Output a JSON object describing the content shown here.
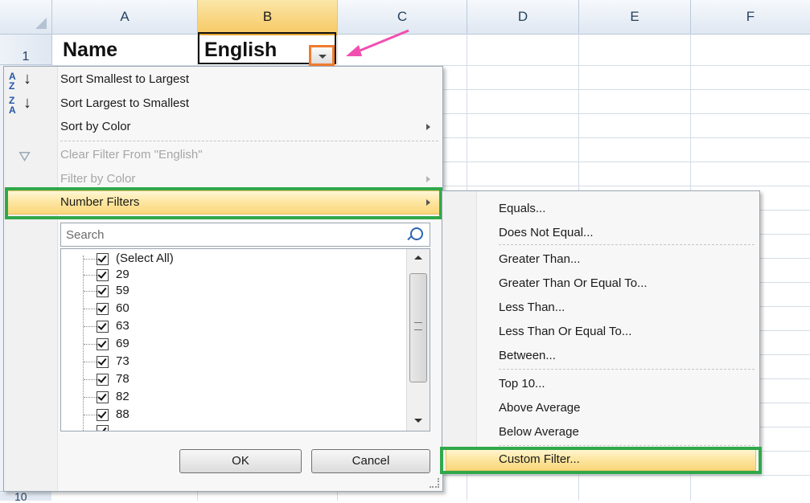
{
  "columns": [
    "A",
    "B",
    "C",
    "D",
    "E",
    "F"
  ],
  "rows": [
    "1",
    "10"
  ],
  "cells": {
    "A1": "Name",
    "B1": "English"
  },
  "autofilter_menu": {
    "sort_asc": "Sort Smallest to Largest",
    "sort_desc": "Sort Largest to Smallest",
    "sort_color": "Sort by Color",
    "clear_filter": "Clear Filter From \"English\"",
    "filter_color": "Filter by Color",
    "number_filters": "Number Filters",
    "search_placeholder": "Search",
    "values": [
      "(Select All)",
      "29",
      "59",
      "60",
      "63",
      "69",
      "73",
      "78",
      "82",
      "88"
    ],
    "ok": "OK",
    "cancel": "Cancel"
  },
  "number_filters_submenu": [
    "Equals...",
    "Does Not Equal...",
    "Greater Than...",
    "Greater Than Or Equal To...",
    "Less Than...",
    "Less Than Or Equal To...",
    "Between...",
    "Top 10...",
    "Above Average",
    "Below Average",
    "Custom Filter..."
  ],
  "colors": {
    "highlight_green": "#30a84a",
    "dropdown_orange": "#f07c2e",
    "annotation_pink": "#f04fb0",
    "menu_hover": "#fde7a3"
  },
  "icons": {
    "sort_asc": "sort-az-icon",
    "sort_desc": "sort-za-icon",
    "clear_filter": "clear-filter-icon",
    "search": "search-icon"
  }
}
